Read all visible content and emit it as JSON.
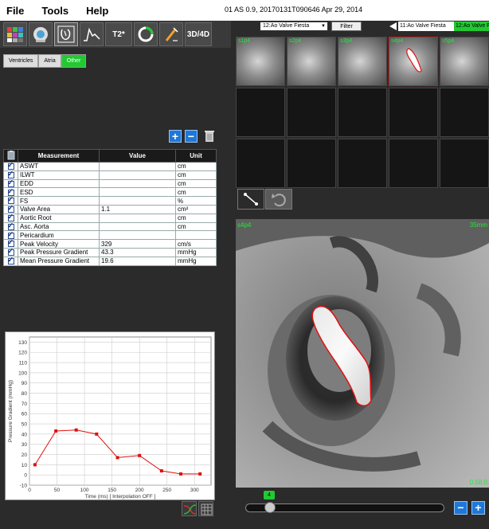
{
  "menu": {
    "file": "File",
    "tools": "Tools",
    "help": "Help"
  },
  "study_info": "01 AS 0.9, 20170131T090646   Apr 29, 2014",
  "toolbar": {
    "t2_label": "T2*",
    "threed_label": "3D/4D"
  },
  "tabs": [
    {
      "label": "Ventricles",
      "selected": false
    },
    {
      "label": "Atria",
      "selected": false
    },
    {
      "label": "Other",
      "selected": true
    }
  ],
  "table": {
    "headers": {
      "measurement": "Measurement",
      "value": "Value",
      "unit": "Unit"
    },
    "rows": [
      {
        "name": "ASWT",
        "value": "",
        "unit": "cm"
      },
      {
        "name": "ILWT",
        "value": "",
        "unit": "cm"
      },
      {
        "name": "EDD",
        "value": "",
        "unit": "cm"
      },
      {
        "name": "ESD",
        "value": "",
        "unit": "cm"
      },
      {
        "name": "FS",
        "value": "",
        "unit": "%"
      },
      {
        "name": "Valve Area",
        "value": "1.1",
        "unit": "cm²"
      },
      {
        "name": "Aortic Root",
        "value": "",
        "unit": "cm"
      },
      {
        "name": "Asc. Aorta",
        "value": "",
        "unit": "cm"
      },
      {
        "name": "Pericardium",
        "value": "",
        "unit": ""
      },
      {
        "name": "Peak Velocity",
        "value": "329",
        "unit": "cm/s"
      },
      {
        "name": "Peak Pressure Gradient",
        "value": "43.3",
        "unit": "mmHg"
      },
      {
        "name": "Mean Pressure Gradient",
        "value": "19.6",
        "unit": "mmHg"
      }
    ]
  },
  "chart_data": {
    "type": "line",
    "x": [
      10,
      48,
      85,
      122,
      160,
      200,
      240,
      275,
      310
    ],
    "series": [
      {
        "values": [
          10,
          43,
          44,
          40,
          17,
          19,
          4,
          1,
          1
        ],
        "color": "#e01010"
      }
    ],
    "xlabel": "Time (ms)  [ Interpolation OFF ]",
    "ylabel": "Pressure Gradient (mmHg)",
    "xlim": [
      0,
      330
    ],
    "ylim": [
      -10,
      135
    ],
    "xticks": [
      0,
      50,
      100,
      150,
      200,
      250,
      300
    ],
    "yticks": [
      -10,
      0,
      10,
      20,
      30,
      40,
      50,
      60,
      70,
      80,
      90,
      100,
      110,
      120,
      130
    ],
    "grid": true
  },
  "series_select": {
    "dropdown_value": "12:Ao Valve Fiesta",
    "filter_label": "Filter",
    "left_series": "11:Ao Valve Fiesta",
    "right_series": "12:Ao Valve Fiesta"
  },
  "thumbnails": [
    {
      "label": "s1p4",
      "selected": false
    },
    {
      "label": "s2p4",
      "selected": false
    },
    {
      "label": "s3p4",
      "selected": false
    },
    {
      "label": "s4p4",
      "selected": true
    },
    {
      "label": "s5p4",
      "selected": false
    }
  ],
  "viewport": {
    "label_tl": "s4p4",
    "label_tr": "35mm",
    "label_br": "0.58.0"
  },
  "slider": {
    "phase_value": "4"
  }
}
